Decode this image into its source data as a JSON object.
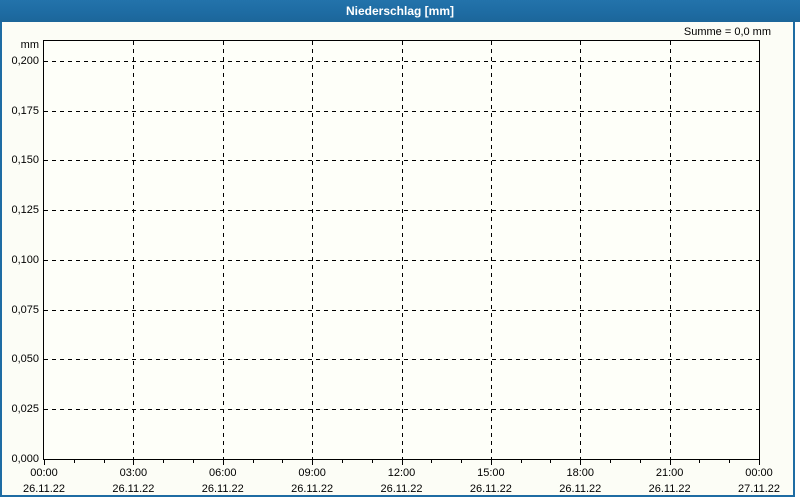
{
  "window": {
    "title": "Niederschlag [mm]"
  },
  "summary_label": "Summe = 0,0 mm",
  "colors": {
    "frame_blue": "#1e6ca3",
    "grid_line": "#000000",
    "background": "#fcfdf6",
    "plot_background": "#fefff9",
    "title_text": "#ffffff"
  },
  "chart_data": {
    "type": "bar",
    "title": "Niederschlag [mm]",
    "ylabel_unit": "mm",
    "y_ticks": [
      0.0,
      0.025,
      0.05,
      0.075,
      0.1,
      0.125,
      0.15,
      0.175,
      0.2
    ],
    "y_tick_labels": [
      "0,000",
      "0,025",
      "0,050",
      "0,075",
      "0,100",
      "0,125",
      "0,150",
      "0,175",
      "0,200"
    ],
    "ylim": [
      0,
      0.21
    ],
    "x_ticks": [
      {
        "time": "00:00",
        "date": "26.11.22"
      },
      {
        "time": "03:00",
        "date": "26.11.22"
      },
      {
        "time": "06:00",
        "date": "26.11.22"
      },
      {
        "time": "09:00",
        "date": "26.11.22"
      },
      {
        "time": "12:00",
        "date": "26.11.22"
      },
      {
        "time": "15:00",
        "date": "26.11.22"
      },
      {
        "time": "18:00",
        "date": "26.11.22"
      },
      {
        "time": "21:00",
        "date": "26.11.22"
      },
      {
        "time": "00:00",
        "date": "27.11.22"
      }
    ],
    "minor_ticks_per_interval": 2,
    "grid": true,
    "series": [
      {
        "name": "Niederschlag",
        "values": [],
        "sum_mm": 0.0
      }
    ],
    "annotation": "Summe = 0,0 mm"
  }
}
